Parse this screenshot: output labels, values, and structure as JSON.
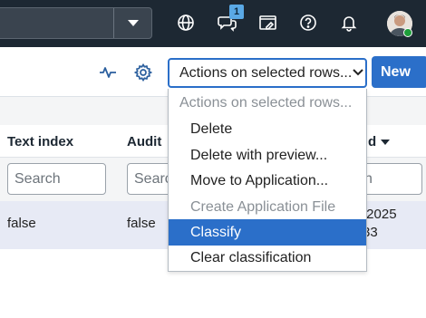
{
  "navbar": {
    "icons": [
      "globe-icon",
      "chat-icon",
      "window-edit-icon",
      "help-icon",
      "bell-icon"
    ],
    "chat_badge": "1"
  },
  "toolbar": {
    "actions_select_value": "Actions on selected rows...",
    "new_label": "New"
  },
  "grid": {
    "columns": [
      "Text index",
      "Audit",
      "d"
    ],
    "filters": [
      "Search",
      "Searc",
      "h"
    ],
    "row": {
      "text_index": "false",
      "audit": "false",
      "date_line1": "/2025",
      "date_line2": "33"
    }
  },
  "actions_menu": {
    "items": [
      {
        "label": "Actions on selected rows...",
        "state": "header"
      },
      {
        "label": "Delete",
        "state": "normal"
      },
      {
        "label": "Delete with preview...",
        "state": "normal"
      },
      {
        "label": "Move to Application...",
        "state": "normal"
      },
      {
        "label": "Create Application File",
        "state": "disabled"
      },
      {
        "label": "Classify",
        "state": "selected"
      },
      {
        "label": "Clear classification",
        "state": "normal"
      }
    ]
  },
  "colors": {
    "navbar": "#1d2833",
    "accent": "#2b6fc9",
    "row_highlight": "#e7eaf5"
  }
}
